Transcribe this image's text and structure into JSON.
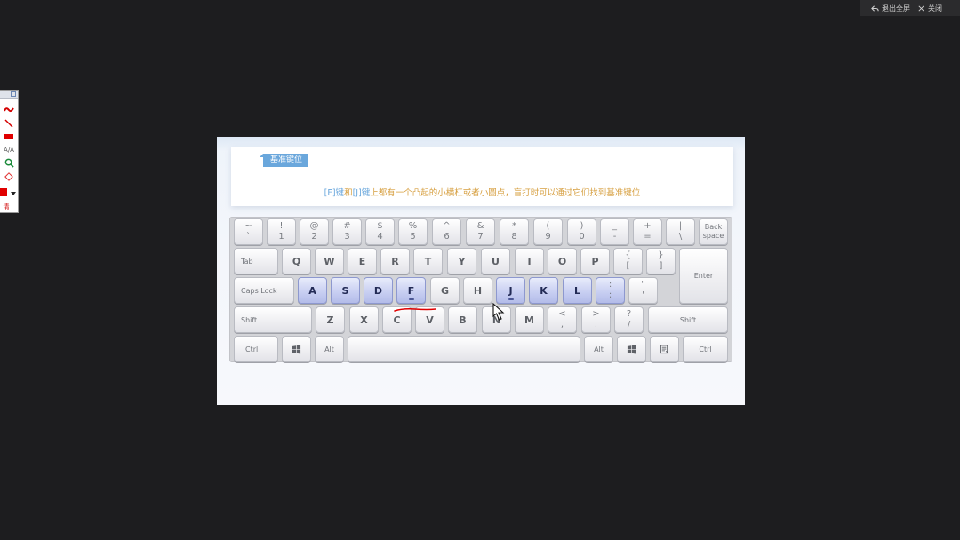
{
  "window": {
    "exit_fullscreen_label": "退出全屏",
    "close_label": "关闭"
  },
  "toolbar": {
    "text_tool_label": "A/A",
    "clear_label": "清"
  },
  "slide": {
    "badge": "基准键位",
    "desc_f": "[F]键",
    "desc_and": "和",
    "desc_j": "[J]键",
    "desc_rest": "上都有一个凸起的小横杠或者小圆点，盲打时可以通过它们找到基准键位"
  },
  "keyboard": {
    "row1": [
      {
        "top": "~",
        "bot": "`"
      },
      {
        "top": "!",
        "bot": "1"
      },
      {
        "top": "@",
        "bot": "2"
      },
      {
        "top": "#",
        "bot": "3"
      },
      {
        "top": "$",
        "bot": "4"
      },
      {
        "top": "%",
        "bot": "5"
      },
      {
        "top": "^",
        "bot": "6"
      },
      {
        "top": "&",
        "bot": "7"
      },
      {
        "top": "*",
        "bot": "8"
      },
      {
        "top": "(",
        "bot": "9"
      },
      {
        "top": ")",
        "bot": "0"
      },
      {
        "top": "_",
        "bot": "-"
      },
      {
        "top": "+",
        "bot": "="
      },
      {
        "top": "|",
        "bot": "\\"
      }
    ],
    "backspace": [
      "Back",
      "space"
    ],
    "tab": "Tab",
    "row2": [
      "Q",
      "W",
      "E",
      "R",
      "T",
      "Y",
      "U",
      "I",
      "O",
      "P"
    ],
    "row2_brackets": [
      {
        "top": "{",
        "bot": "["
      },
      {
        "top": "}",
        "bot": "]"
      }
    ],
    "caps": "Caps Lock",
    "row3": [
      "A",
      "S",
      "D",
      "F",
      "G",
      "H",
      "J",
      "K",
      "L"
    ],
    "row3_punct": [
      {
        "top": ":",
        "bot": ";"
      },
      {
        "top": "\"",
        "bot": "'"
      }
    ],
    "enter": "Enter",
    "shift": "Shift",
    "row4": [
      "Z",
      "X",
      "C",
      "V",
      "B",
      "N",
      "M"
    ],
    "row4_punct": [
      {
        "top": "<",
        "bot": ","
      },
      {
        "top": ">",
        "bot": "."
      },
      {
        "top": "?",
        "bot": "/"
      }
    ],
    "ctrl": "Ctrl",
    "alt": "Alt"
  },
  "colors": {
    "highlight_key": "#b3bce9",
    "badge": "#6aa7dc",
    "description_text": "#d7a042",
    "annotation_pen": "#e00000"
  }
}
